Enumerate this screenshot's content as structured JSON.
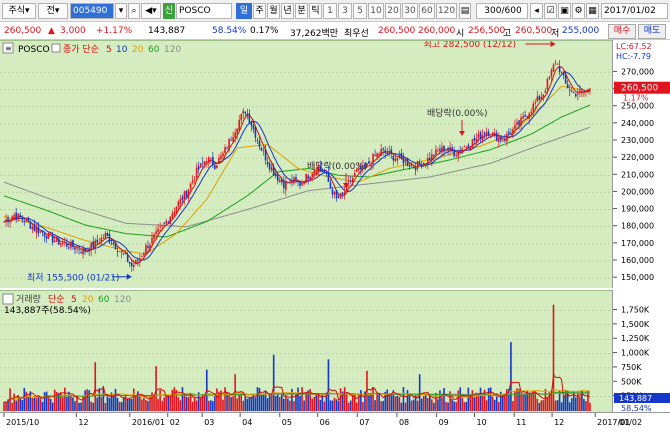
{
  "toolbar": {
    "market": "주식",
    "market_mode": "전",
    "code": "005490",
    "name_badge": "신",
    "stock_name": "POSCO",
    "periods": [
      "일",
      "주",
      "월",
      "년",
      "분",
      "틱"
    ],
    "minutes": [
      "1",
      "3",
      "5",
      "10",
      "20",
      "30",
      "60",
      "120"
    ],
    "count": "300/600",
    "date": "2017/01/02"
  },
  "quote": {
    "price": "260,500",
    "change": "3,000",
    "change_pct": "+1.17%",
    "volume": "143,887",
    "volume_ratio": "58.54%",
    "turnover_ratio": "0.17%",
    "amount": "37,262백만",
    "best_ask_label": "최우선",
    "best_bid": "260,500",
    "best_ask": "260,000",
    "open_label": "시",
    "open": "256,500",
    "high_label": "고",
    "high": "260,500",
    "low_label": "저",
    "low": "255,000",
    "buy_button": "매수",
    "sell_button": "매도"
  },
  "colors": {
    "up": "#e0141e",
    "down": "#1437c8",
    "pane_bg": "#d4ecbf",
    "ma5": "#d01010",
    "ma10": "#1437c8",
    "ma20": "#e0a000",
    "ma60": "#1ea01e",
    "ma120": "#8c8c8c"
  },
  "chart_data": [
    {
      "type": "candlestick",
      "legend": {
        "symbol": "POSCO",
        "series_label": "종가 단순",
        "ma_periods": [
          "5",
          "10",
          "20",
          "60",
          "120"
        ]
      },
      "lc_label": "LC:67.52",
      "hc_label": "HC:-7.79",
      "current_price_tag": "260,500",
      "current_pct_tag": "1.17%",
      "y_ticks": [
        "270,000",
        "260,000",
        "250,000",
        "240,000",
        "230,000",
        "220,000",
        "210,000",
        "200,000",
        "190,000",
        "180,000",
        "170,000",
        "160,000",
        "150,000"
      ],
      "ylim": [
        146000,
        279000
      ],
      "annotations": [
        {
          "text": "최고 282,500 (12/12)",
          "kind": "high"
        },
        {
          "text": "최저 155,500 (01/21)",
          "kind": "low"
        },
        {
          "text": "배당락(0.00%)",
          "kind": "dividend"
        },
        {
          "text": "배당락(0.00%)",
          "kind": "dividend"
        }
      ],
      "close_path": [
        [
          0,
          183000
        ],
        [
          5,
          187000
        ],
        [
          10,
          184000
        ],
        [
          15,
          179000
        ],
        [
          20,
          176000
        ],
        [
          25,
          172000
        ],
        [
          30,
          170000
        ],
        [
          35,
          168000
        ],
        [
          40,
          166000
        ],
        [
          45,
          170000
        ],
        [
          50,
          175000
        ],
        [
          55,
          169000
        ],
        [
          60,
          162000
        ],
        [
          63,
          157000
        ],
        [
          66,
          160000
        ],
        [
          70,
          168000
        ],
        [
          75,
          175000
        ],
        [
          80,
          183000
        ],
        [
          85,
          192000
        ],
        [
          90,
          200000
        ],
        [
          95,
          212000
        ],
        [
          100,
          220000
        ],
        [
          104,
          216000
        ],
        [
          108,
          222000
        ],
        [
          112,
          232000
        ],
        [
          116,
          242000
        ],
        [
          119,
          248000
        ],
        [
          122,
          240000
        ],
        [
          126,
          228000
        ],
        [
          130,
          218000
        ],
        [
          134,
          210000
        ],
        [
          138,
          205000
        ],
        [
          142,
          207000
        ],
        [
          146,
          205000
        ],
        [
          150,
          210000
        ],
        [
          154,
          215000
        ],
        [
          158,
          212000
        ],
        [
          161,
          203000
        ],
        [
          164,
          196000
        ],
        [
          167,
          198000
        ],
        [
          170,
          205000
        ],
        [
          174,
          212000
        ],
        [
          178,
          214000
        ],
        [
          182,
          220000
        ],
        [
          186,
          224000
        ],
        [
          190,
          222000
        ],
        [
          194,
          220000
        ],
        [
          198,
          218000
        ],
        [
          202,
          215000
        ],
        [
          206,
          217000
        ],
        [
          210,
          220000
        ],
        [
          214,
          224000
        ],
        [
          218,
          226000
        ],
        [
          222,
          223000
        ],
        [
          226,
          226000
        ],
        [
          230,
          229000
        ],
        [
          234,
          232000
        ],
        [
          238,
          236000
        ],
        [
          242,
          233000
        ],
        [
          246,
          231000
        ],
        [
          250,
          235000
        ],
        [
          254,
          240000
        ],
        [
          258,
          246000
        ],
        [
          262,
          252000
        ],
        [
          266,
          258000
        ],
        [
          270,
          270000
        ],
        [
          272,
          277000
        ],
        [
          274,
          272000
        ],
        [
          277,
          263000
        ],
        [
          281,
          258000
        ],
        [
          285,
          258000
        ],
        [
          289,
          260500
        ]
      ],
      "ma20_path": [
        [
          0,
          186000
        ],
        [
          20,
          180000
        ],
        [
          40,
          172000
        ],
        [
          60,
          166000
        ],
        [
          70,
          164000
        ],
        [
          85,
          176000
        ],
        [
          100,
          196000
        ],
        [
          115,
          226000
        ],
        [
          130,
          228000
        ],
        [
          145,
          214000
        ],
        [
          160,
          209000
        ],
        [
          175,
          206000
        ],
        [
          190,
          214000
        ],
        [
          205,
          218000
        ],
        [
          220,
          222000
        ],
        [
          235,
          227000
        ],
        [
          250,
          234000
        ],
        [
          265,
          250000
        ],
        [
          275,
          262000
        ],
        [
          289,
          259000
        ]
      ],
      "ma60_path": [
        [
          0,
          198000
        ],
        [
          20,
          190000
        ],
        [
          40,
          181000
        ],
        [
          60,
          176000
        ],
        [
          80,
          174000
        ],
        [
          100,
          183000
        ],
        [
          120,
          198000
        ],
        [
          135,
          212000
        ],
        [
          150,
          214000
        ],
        [
          165,
          210000
        ],
        [
          180,
          209000
        ],
        [
          200,
          214000
        ],
        [
          220,
          219000
        ],
        [
          240,
          225000
        ],
        [
          260,
          234000
        ],
        [
          275,
          244000
        ],
        [
          289,
          251000
        ]
      ],
      "ma120_path": [
        [
          0,
          206000
        ],
        [
          30,
          193000
        ],
        [
          60,
          182000
        ],
        [
          90,
          180000
        ],
        [
          120,
          190000
        ],
        [
          150,
          201000
        ],
        [
          180,
          205000
        ],
        [
          210,
          209000
        ],
        [
          240,
          217000
        ],
        [
          265,
          228000
        ],
        [
          289,
          238000
        ]
      ]
    },
    {
      "type": "bar",
      "legend": {
        "label": "거래량",
        "series_label": "단순",
        "ma_periods": [
          "5",
          "20",
          "60",
          "120"
        ],
        "value": "143,887주(58.54%)"
      },
      "current_volume_tag": "143,887",
      "current_pct_tag": "58.54%",
      "y_ticks": [
        "1,750K",
        "1,500K",
        "1,250K",
        "1,000K",
        "750K",
        "500K",
        "250K"
      ],
      "ylim": [
        0,
        1950000
      ],
      "typical_volume": 310000,
      "spikes": [
        {
          "x": 45,
          "value": 850000
        },
        {
          "x": 75,
          "value": 780000
        },
        {
          "x": 100,
          "value": 720000
        },
        {
          "x": 114,
          "value": 640000
        },
        {
          "x": 133,
          "value": 980000
        },
        {
          "x": 160,
          "value": 900000
        },
        {
          "x": 179,
          "value": 700000
        },
        {
          "x": 205,
          "value": 640000
        },
        {
          "x": 250,
          "value": 1200000
        },
        {
          "x": 271,
          "value": 1850000
        }
      ]
    }
  ],
  "x_axis": {
    "labels": [
      "2015/10",
      "12",
      "2016/01",
      "02",
      "03",
      "04",
      "05",
      "06",
      "07",
      "08",
      "09",
      "10",
      "11",
      "12",
      "2017/01"
    ],
    "end_label": "01/02",
    "bar_count": 290
  }
}
